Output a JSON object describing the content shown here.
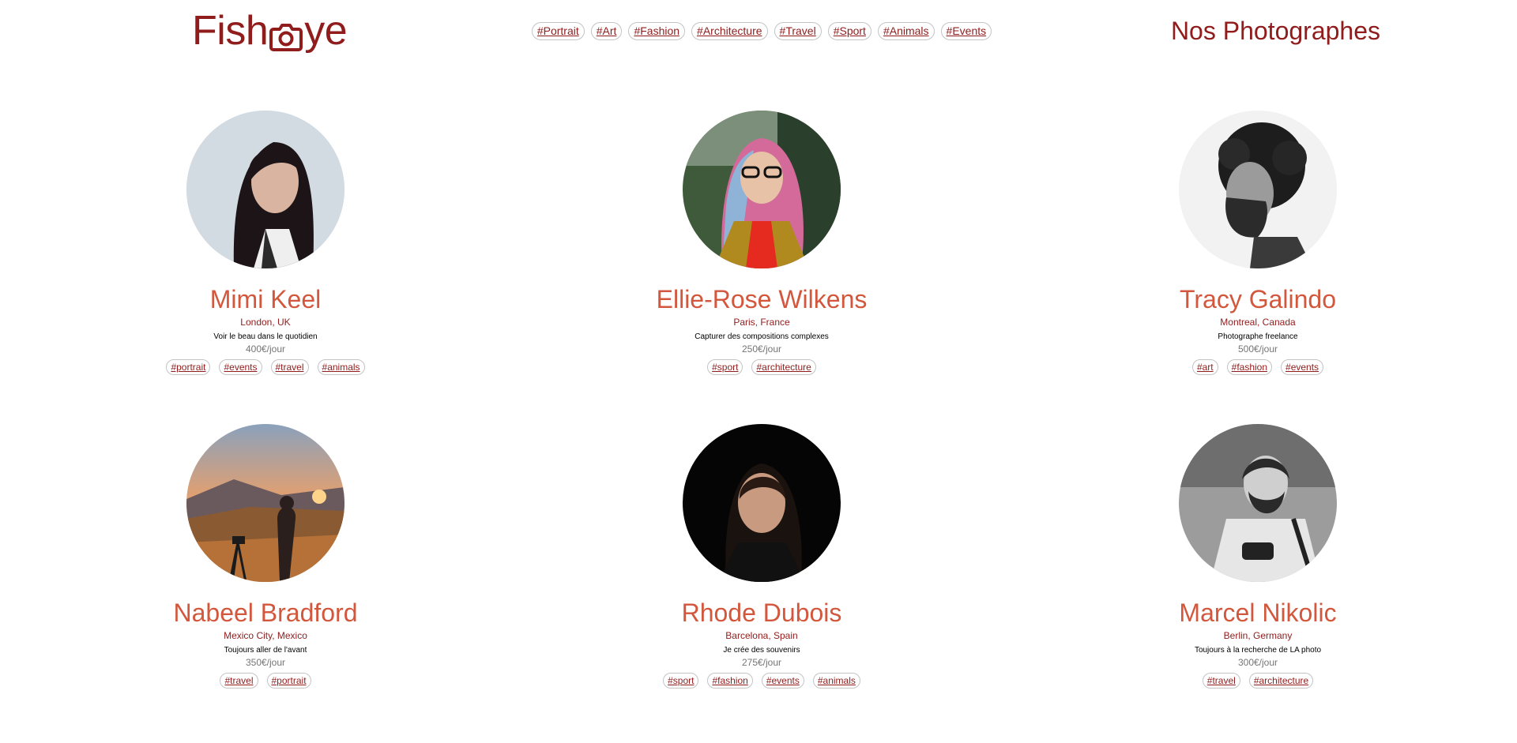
{
  "header": {
    "logo": {
      "before": "Fish",
      "after": "ye",
      "icon": "camera-icon"
    },
    "nav_tags": [
      "#Portrait",
      "#Art",
      "#Fashion",
      "#Architecture",
      "#Travel",
      "#Sport",
      "#Animals",
      "#Events"
    ],
    "title": "Nos Photographes"
  },
  "colors": {
    "brand": "#901c1c",
    "accent": "#d3573c",
    "price": "#757575",
    "tag_border": "#c4c4c4"
  },
  "photographers": [
    {
      "name": "Mimi Keel",
      "location": "London, UK",
      "tagline": "Voir le beau dans le quotidien",
      "price": "400€/jour",
      "tags": [
        "#portrait",
        "#events",
        "#travel",
        "#animals"
      ],
      "portrait": "portrait-mimi-keel"
    },
    {
      "name": "Ellie-Rose Wilkens",
      "location": "Paris, France",
      "tagline": "Capturer des compositions complexes",
      "price": "250€/jour",
      "tags": [
        "#sport",
        "#architecture"
      ],
      "portrait": "portrait-ellie-rose-wilkens"
    },
    {
      "name": "Tracy Galindo",
      "location": "Montreal, Canada",
      "tagline": "Photographe freelance",
      "price": "500€/jour",
      "tags": [
        "#art",
        "#fashion",
        "#events"
      ],
      "portrait": "portrait-tracy-galindo"
    },
    {
      "name": "Nabeel Bradford",
      "location": "Mexico City, Mexico",
      "tagline": "Toujours aller de l'avant",
      "price": "350€/jour",
      "tags": [
        "#travel",
        "#portrait"
      ],
      "portrait": "portrait-nabeel-bradford"
    },
    {
      "name": "Rhode Dubois",
      "location": "Barcelona, Spain",
      "tagline": "Je crée des souvenirs",
      "price": "275€/jour",
      "tags": [
        "#sport",
        "#fashion",
        "#events",
        "#animals"
      ],
      "portrait": "portrait-rhode-dubois"
    },
    {
      "name": "Marcel Nikolic",
      "location": "Berlin, Germany",
      "tagline": "Toujours à la recherche de LA photo",
      "price": "300€/jour",
      "tags": [
        "#travel",
        "#architecture"
      ],
      "portrait": "portrait-marcel-nikolic"
    }
  ]
}
